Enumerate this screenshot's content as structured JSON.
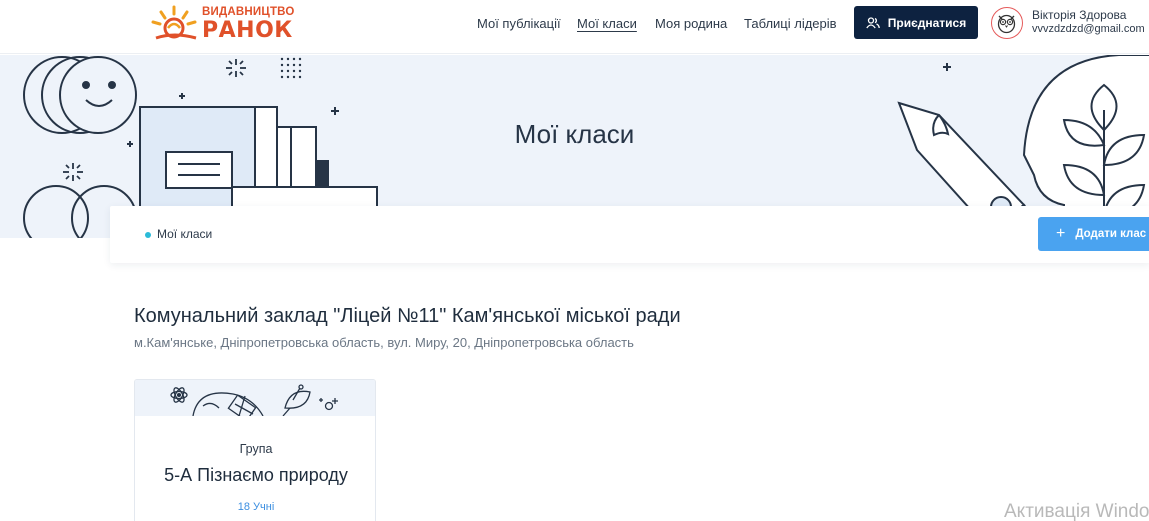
{
  "brand": {
    "top_text": "ВИДАВНИЦТВО",
    "main_text": "РАНОК",
    "color": "#e0512a"
  },
  "nav": {
    "items": [
      {
        "label": "Мої публікації"
      },
      {
        "label": "Мої класи",
        "active": true
      },
      {
        "label": "Моя родина"
      },
      {
        "label": "Таблиці лідерів"
      }
    ],
    "join_label": "Приєднатися"
  },
  "user": {
    "name": "Вікторія Здорова",
    "email": "vvvzdzdzd@gmail.com"
  },
  "hero": {
    "title": "Мої класи"
  },
  "breadcrumb": {
    "current": "Мої класи"
  },
  "actions": {
    "add_class_label": "Додати клас"
  },
  "school": {
    "name": "Комунальний заклад \"Ліцей №11\" Кам'янської міської ради",
    "address": "м.Кам'янське, Дніпропетровська область, вул. Миру, 20, Дніпропетровська область"
  },
  "classes": [
    {
      "type": "Група",
      "name": "5-А Пізнаємо природу",
      "students": "18 Учні"
    }
  ],
  "watermark": "Активація Windo",
  "colors": {
    "accent": "#4aa3f0",
    "dark_button": "#0d2240",
    "hero_bg": "#eef3fa",
    "crumb_dot": "#2bbbd8"
  }
}
